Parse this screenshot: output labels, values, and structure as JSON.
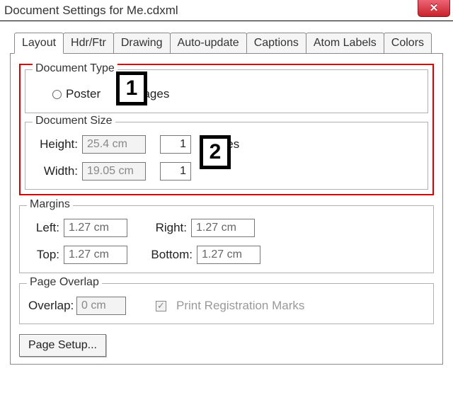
{
  "window": {
    "title": "Document Settings for Me.cdxml",
    "close": "✕"
  },
  "tabs": {
    "layout": "Layout",
    "hdrftr": "Hdr/Ftr",
    "drawing": "Drawing",
    "autoupdate": "Auto-update",
    "captions": "Captions",
    "atomlabels": "Atom Labels",
    "colors": "Colors"
  },
  "doc_type": {
    "legend": "Document Type",
    "poster": "Poster",
    "pages": "Pages",
    "selected": "pages"
  },
  "doc_size": {
    "legend": "Document Size",
    "height_label": "Height:",
    "height_value": "25.4 cm",
    "height_pages": "1",
    "height_pages_label": "Pages",
    "width_label": "Width:",
    "width_value": "19.05 cm",
    "width_pages": "1"
  },
  "margins": {
    "legend": "Margins",
    "left_label": "Left:",
    "left_value": "1.27 cm",
    "right_label": "Right:",
    "right_value": "1.27 cm",
    "top_label": "Top:",
    "top_value": "1.27 cm",
    "bottom_label": "Bottom:",
    "bottom_value": "1.27 cm"
  },
  "overlap": {
    "legend": "Page Overlap",
    "label": "Overlap:",
    "value": "0 cm",
    "print_reg": "Print Registration Marks",
    "print_reg_checked": true
  },
  "buttons": {
    "page_setup": "Page Setup..."
  },
  "callouts": {
    "c1": "1",
    "c2": "2"
  }
}
